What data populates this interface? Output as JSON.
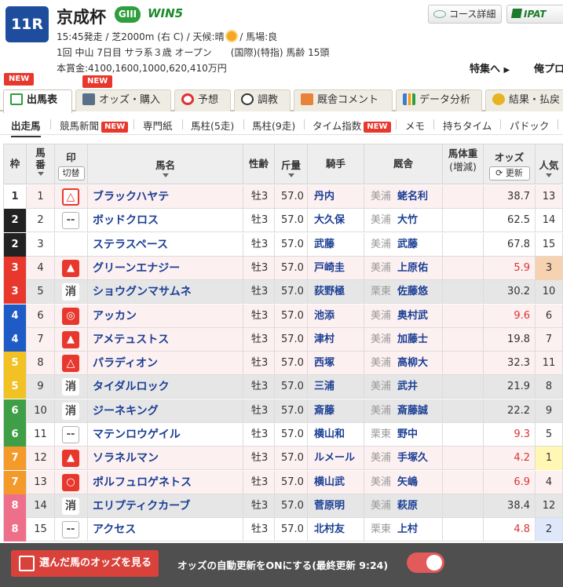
{
  "race": {
    "number": "11R",
    "name": "京成杯",
    "grade": "GIII",
    "win5": "WIN5",
    "line1": "15:45発走 / 芝2000m (右 C) / 天候:晴",
    "line1b": "/ 馬場:良",
    "line2": "1回 中山 7日目 サラ系３歳 オープン　　(国際)(特指) 馬齢 15頭",
    "line3": "本賞金:4100,1600,1000,620,410万円"
  },
  "header_buttons": {
    "course": "コース詳細",
    "ipat": "IPAT"
  },
  "header_links": {
    "tokushu": "特集へ",
    "ore": "俺プロ"
  },
  "tabs": [
    {
      "label": "出馬表",
      "new": "NEW"
    },
    {
      "label": "オッズ・購入",
      "new": "NEW"
    },
    {
      "label": "予想"
    },
    {
      "label": "調教"
    },
    {
      "label": "厩舎コメント"
    },
    {
      "label": "データ分析"
    },
    {
      "label": "結果・払戻"
    }
  ],
  "subnav": [
    {
      "label": "出走馬"
    },
    {
      "label": "競馬新聞",
      "new": "NEW"
    },
    {
      "label": "専門紙"
    },
    {
      "label": "馬柱(5走)"
    },
    {
      "label": "馬柱(9走)"
    },
    {
      "label": "タイム指数",
      "new": "NEW"
    },
    {
      "label": "メモ"
    },
    {
      "label": "持ちタイム"
    },
    {
      "label": "パドック"
    }
  ],
  "table_headers": {
    "waku": "枠",
    "umaban": "馬番",
    "shirushi": "印",
    "kirikae": "切替",
    "bamei": "馬名",
    "seirei": "性齢",
    "kinryo": "斤量",
    "kishu": "騎手",
    "kyusha": "厩舎",
    "bataiju": "馬体重",
    "zogen": "(増減)",
    "odds": "オッズ",
    "koshin": "更新",
    "ninki": "人気"
  },
  "colors": {
    "waku1": "#ffffff",
    "waku2": "#222222",
    "waku3": "#e8382e",
    "waku4": "#1e5bc6",
    "waku5": "#f2c224",
    "waku6": "#3e9f47",
    "waku7": "#f39a2a",
    "waku8": "#ee6f8a"
  },
  "rows": [
    {
      "waku": "1",
      "umaban": "1",
      "mark": "△",
      "markType": "red-outline",
      "name": "ブラックハヤテ",
      "sex": "牡3",
      "kin": "57.0",
      "jockey": "丹内",
      "area": "美浦",
      "trainer": "蛯名利",
      "odds": "38.7",
      "oddsHi": false,
      "ninki": "13",
      "ninkiCls": "",
      "rowCls": "pick"
    },
    {
      "waku": "2",
      "umaban": "2",
      "mark": "--",
      "markType": "dash",
      "name": "ボッドクロス",
      "sex": "牡3",
      "kin": "57.0",
      "jockey": "大久保",
      "area": "美浦",
      "trainer": "大竹",
      "odds": "62.5",
      "oddsHi": false,
      "ninki": "14",
      "ninkiCls": "",
      "rowCls": ""
    },
    {
      "waku": "2",
      "umaban": "3",
      "mark": "",
      "markType": "none",
      "name": "ステラスペース",
      "sex": "牡3",
      "kin": "57.0",
      "jockey": "武藤",
      "area": "美浦",
      "trainer": "武藤",
      "odds": "67.8",
      "oddsHi": false,
      "ninki": "15",
      "ninkiCls": "",
      "rowCls": ""
    },
    {
      "waku": "3",
      "umaban": "4",
      "mark": "▲",
      "markType": "red",
      "name": "グリーンエナジー",
      "sex": "牡3",
      "kin": "57.0",
      "jockey": "戸崎圭",
      "area": "美浦",
      "trainer": "上原佑",
      "odds": "5.9",
      "oddsHi": true,
      "ninki": "3",
      "ninkiCls": "ninki3",
      "rowCls": "pick"
    },
    {
      "waku": "3",
      "umaban": "5",
      "mark": "消",
      "markType": "kesu",
      "name": "ショウグンマサムネ",
      "sex": "牡3",
      "kin": "57.0",
      "jockey": "荻野極",
      "area": "栗東",
      "trainer": "佐藤悠",
      "odds": "30.2",
      "oddsHi": false,
      "ninki": "10",
      "ninkiCls": "",
      "rowCls": "scr"
    },
    {
      "waku": "4",
      "umaban": "6",
      "mark": "◎",
      "markType": "red",
      "name": "アッカン",
      "sex": "牡3",
      "kin": "57.0",
      "jockey": "池添",
      "area": "美浦",
      "trainer": "奥村武",
      "odds": "9.6",
      "oddsHi": true,
      "ninki": "6",
      "ninkiCls": "",
      "rowCls": "pick"
    },
    {
      "waku": "4",
      "umaban": "7",
      "mark": "▲",
      "markType": "red",
      "name": "アメテュストス",
      "sex": "牡3",
      "kin": "57.0",
      "jockey": "津村",
      "area": "美浦",
      "trainer": "加藤士",
      "odds": "19.8",
      "oddsHi": false,
      "ninki": "7",
      "ninkiCls": "",
      "rowCls": "pick"
    },
    {
      "waku": "5",
      "umaban": "8",
      "mark": "△",
      "markType": "red",
      "name": "パラディオン",
      "sex": "牡3",
      "kin": "57.0",
      "jockey": "西塚",
      "area": "美浦",
      "trainer": "高柳大",
      "odds": "32.3",
      "oddsHi": false,
      "ninki": "11",
      "ninkiCls": "",
      "rowCls": "pick"
    },
    {
      "waku": "5",
      "umaban": "9",
      "mark": "消",
      "markType": "kesu",
      "name": "タイダルロック",
      "sex": "牡3",
      "kin": "57.0",
      "jockey": "三浦",
      "area": "美浦",
      "trainer": "武井",
      "odds": "21.9",
      "oddsHi": false,
      "ninki": "8",
      "ninkiCls": "",
      "rowCls": "scr"
    },
    {
      "waku": "6",
      "umaban": "10",
      "mark": "消",
      "markType": "kesu",
      "name": "ジーネキング",
      "sex": "牡3",
      "kin": "57.0",
      "jockey": "斎藤",
      "area": "美浦",
      "trainer": "斎藤誠",
      "odds": "22.2",
      "oddsHi": false,
      "ninki": "9",
      "ninkiCls": "",
      "rowCls": "scr"
    },
    {
      "waku": "6",
      "umaban": "11",
      "mark": "--",
      "markType": "dash",
      "name": "マテンロウゲイル",
      "sex": "牡3",
      "kin": "57.0",
      "jockey": "横山和",
      "area": "栗東",
      "trainer": "野中",
      "odds": "9.3",
      "oddsHi": true,
      "ninki": "5",
      "ninkiCls": "",
      "rowCls": ""
    },
    {
      "waku": "7",
      "umaban": "12",
      "mark": "▲",
      "markType": "red",
      "name": "ソラネルマン",
      "sex": "牡3",
      "kin": "57.0",
      "jockey": "ルメール",
      "area": "美浦",
      "trainer": "手塚久",
      "odds": "4.2",
      "oddsHi": true,
      "ninki": "1",
      "ninkiCls": "ninki1",
      "rowCls": "pick"
    },
    {
      "waku": "7",
      "umaban": "13",
      "mark": "○",
      "markType": "red",
      "name": "ポルフュロゲネトス",
      "sex": "牡3",
      "kin": "57.0",
      "jockey": "横山武",
      "area": "美浦",
      "trainer": "矢嶋",
      "odds": "6.9",
      "oddsHi": true,
      "ninki": "4",
      "ninkiCls": "",
      "rowCls": "pick"
    },
    {
      "waku": "8",
      "umaban": "14",
      "mark": "消",
      "markType": "kesu",
      "name": "エリプティクカーブ",
      "sex": "牡3",
      "kin": "57.0",
      "jockey": "菅原明",
      "area": "美浦",
      "trainer": "萩原",
      "odds": "38.4",
      "oddsHi": false,
      "ninki": "12",
      "ninkiCls": "",
      "rowCls": "scr"
    },
    {
      "waku": "8",
      "umaban": "15",
      "mark": "--",
      "markType": "dash",
      "name": "アクセス",
      "sex": "牡3",
      "kin": "57.0",
      "jockey": "北村友",
      "area": "栗東",
      "trainer": "上村",
      "odds": "4.8",
      "oddsHi": true,
      "ninki": "2",
      "ninkiCls": "ninki2",
      "rowCls": ""
    }
  ],
  "bottom": {
    "my_button": "選んだ馬のオッズを見る",
    "auto_update": "オッズの自動更新をONにする(最終更新 9:24)"
  }
}
